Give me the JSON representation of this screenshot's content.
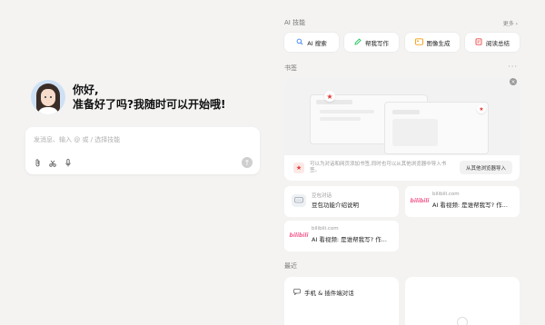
{
  "left": {
    "greeting_line1": "你好,",
    "greeting_line2": "准备好了吗?我随时可以开始哦!",
    "input_placeholder": "发消息、输入 @ 或 / 选择技能",
    "tools": [
      "paperclip-icon",
      "scissors-icon",
      "microphone-icon"
    ],
    "send_icon": "arrow-up-icon"
  },
  "skills": {
    "title": "AI 技能",
    "more": "更多 ›",
    "items": [
      {
        "label": "AI 搜索",
        "icon": "search-icon",
        "color": "#3b82f6"
      },
      {
        "label": "帮我写作",
        "icon": "pen-icon",
        "color": "#22c55e"
      },
      {
        "label": "图像生成",
        "icon": "image-icon",
        "color": "#f59e0b"
      },
      {
        "label": "阅读总结",
        "icon": "book-icon",
        "color": "#ef4444"
      }
    ]
  },
  "bookmarks": {
    "title": "书签",
    "menu": "···",
    "empty_text": "可以为对话和网页添加书签,同时也可以从其他浏览器中导入书签。",
    "import_button": "从其他浏览器导入",
    "items": [
      {
        "source": "豆包对话",
        "title": "豆包功能介绍说明",
        "icon": "message-icon"
      },
      {
        "source": "bilibili.com",
        "title": "AI 看视频: 是谁帮我写? 作...",
        "icon": "bilibili-logo"
      },
      {
        "source": "bilibili.com",
        "title": "AI 看视频: 是谁帮我写? 作...",
        "icon": "bilibili-logo"
      }
    ],
    "bilibili_logo_text": "bilibili"
  },
  "recent": {
    "title": "最近",
    "items": [
      {
        "label": "手机 & 插件端对话",
        "icon": "chat-icon"
      }
    ]
  },
  "colors": {
    "accent": "#e23d3d",
    "background": "#f4f3f2"
  }
}
